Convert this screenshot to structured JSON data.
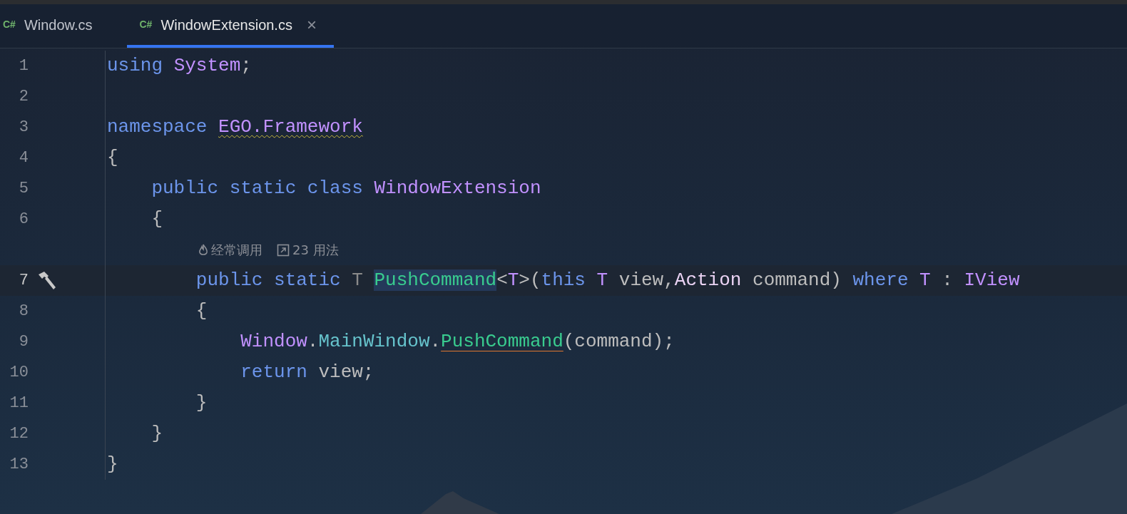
{
  "tabs": [
    {
      "icon": "C#",
      "label": "Window.cs",
      "selected": false,
      "closable": false
    },
    {
      "icon": "C#",
      "label": "WindowExtension.cs",
      "selected": true,
      "closable": true,
      "close": "×"
    }
  ],
  "lines": [
    {
      "number": "1",
      "tokens": [
        {
          "kind": "keyword",
          "text": "using "
        },
        {
          "kind": "type",
          "text": "System"
        },
        {
          "kind": "plain",
          "text": ";"
        }
      ]
    },
    {
      "number": "2"
    },
    {
      "number": "3",
      "tokens": [
        {
          "kind": "keyword",
          "text": "namespace "
        },
        {
          "kind": "type",
          "text": "EGO.Framework",
          "warning": true
        }
      ]
    },
    {
      "number": "4",
      "tokens": [
        {
          "kind": "plain",
          "text": "{"
        }
      ]
    },
    {
      "number": "5",
      "tokens": [
        {
          "kind": "keyword",
          "text": "    public static class "
        },
        {
          "kind": "type",
          "text": "WindowExtension"
        }
      ]
    },
    {
      "number": "6",
      "tokens": [
        {
          "kind": "plain",
          "text": "    {"
        }
      ]
    },
    {
      "number": "7",
      "current": true,
      "implementation_marker": true,
      "hints": [
        {
          "kind": "hot",
          "text": "经常调用"
        },
        {
          "kind": "usages",
          "text": "23 用法"
        }
      ],
      "tokens": [
        {
          "kind": "keyword",
          "text": "        public static "
        },
        {
          "kind": "dim",
          "text": "T "
        },
        {
          "kind": "method",
          "text": "PushCommand",
          "highlight": true
        },
        {
          "kind": "plain",
          "text": "<"
        },
        {
          "kind": "type",
          "text": "T"
        },
        {
          "kind": "plain",
          "text": ">("
        },
        {
          "kind": "keyword",
          "text": "this "
        },
        {
          "kind": "type",
          "text": "T"
        },
        {
          "kind": "plain",
          "text": " view,"
        },
        {
          "kind": "delegate",
          "text": "Action"
        },
        {
          "kind": "plain",
          "text": " command) "
        },
        {
          "kind": "keyword",
          "text": "where "
        },
        {
          "kind": "type",
          "text": "T"
        },
        {
          "kind": "plain",
          "text": " : "
        },
        {
          "kind": "type",
          "text": "IView"
        }
      ]
    },
    {
      "number": "8",
      "tokens": [
        {
          "kind": "plain",
          "text": "        {"
        }
      ]
    },
    {
      "number": "9",
      "tokens": [
        {
          "kind": "type",
          "text": "            Window"
        },
        {
          "kind": "plain",
          "text": "."
        },
        {
          "kind": "member",
          "text": "MainWindow"
        },
        {
          "kind": "plain",
          "text": "."
        },
        {
          "kind": "method",
          "text": "PushCommand",
          "unresolved": true
        },
        {
          "kind": "plain",
          "text": "(command);"
        }
      ]
    },
    {
      "number": "10",
      "tokens": [
        {
          "kind": "keyword",
          "text": "            return "
        },
        {
          "kind": "plain",
          "text": "view;"
        }
      ]
    },
    {
      "number": "11",
      "tokens": [
        {
          "kind": "plain",
          "text": "        }"
        }
      ]
    },
    {
      "number": "12",
      "tokens": [
        {
          "kind": "plain",
          "text": "    }"
        }
      ]
    },
    {
      "number": "13",
      "tokens": [
        {
          "kind": "plain",
          "text": "}"
        }
      ]
    }
  ]
}
